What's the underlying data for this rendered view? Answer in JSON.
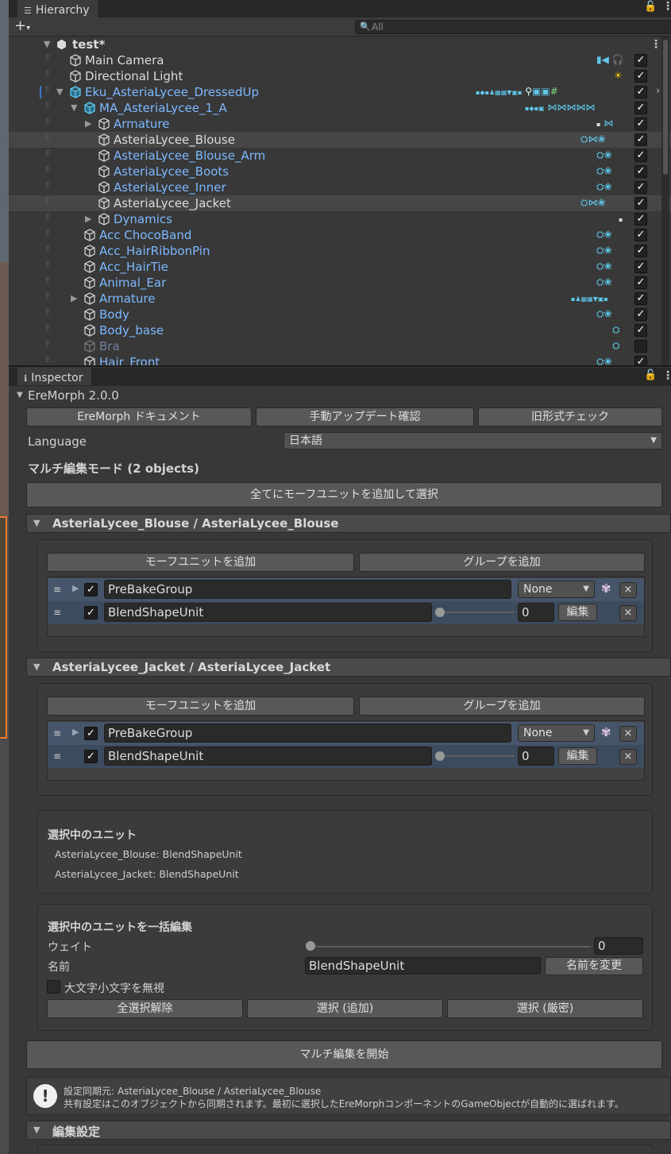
{
  "hierarchy": {
    "tab_title": "Hierarchy",
    "search_placeholder": "All",
    "scene_name": "test*",
    "rows": [
      {
        "name": "Main Camera"
      },
      {
        "name": "Directional Light"
      },
      {
        "name": "Eku_AsteriaLycee_DressedUp"
      },
      {
        "name": "MA_AsteriaLycee_1_A"
      },
      {
        "name": "Armature"
      },
      {
        "name": "AsteriaLycee_Blouse"
      },
      {
        "name": "AsteriaLycee_Blouse_Arm"
      },
      {
        "name": "AsteriaLycee_Boots"
      },
      {
        "name": "AsteriaLycee_Inner"
      },
      {
        "name": "AsteriaLycee_Jacket"
      },
      {
        "name": "Dynamics"
      },
      {
        "name": "Acc ChocoBand"
      },
      {
        "name": "Acc_HairRibbonPin"
      },
      {
        "name": "Acc_HairTie"
      },
      {
        "name": "Animal_Ear"
      },
      {
        "name": "Armature"
      },
      {
        "name": "Body"
      },
      {
        "name": "Body_base"
      },
      {
        "name": "Bra"
      },
      {
        "name": "Hair_Front"
      }
    ]
  },
  "inspector": {
    "tab_title": "Inspector",
    "component_title": "EreMorph 2.0.0",
    "top_buttons": [
      "EreMorph ドキュメント",
      "手動アップデート確認",
      "旧形式チェック"
    ],
    "language_label": "Language",
    "language_value": "日本語",
    "multi_edit_header": "マルチ編集モード (2 objects)",
    "add_all_button": "全てにモーフユニットを追加して選択",
    "sections": [
      {
        "title": "AsteriaLycee_Blouse / AsteriaLycee_Blouse",
        "add_unit_button": "モーフユニットを追加",
        "add_group_button": "グループを追加",
        "group_name": "PreBakeGroup",
        "group_select": "None",
        "unit_name": "BlendShapeUnit",
        "unit_value": "0",
        "edit_button": "編集",
        "remove_symbol": "×"
      },
      {
        "title": "AsteriaLycee_Jacket / AsteriaLycee_Jacket",
        "add_unit_button": "モーフユニットを追加",
        "add_group_button": "グループを追加",
        "group_name": "PreBakeGroup",
        "group_select": "None",
        "unit_name": "BlendShapeUnit",
        "unit_value": "0",
        "edit_button": "編集",
        "remove_symbol": "×"
      }
    ],
    "selected_units": {
      "header": "選択中のユニット",
      "items": [
        "AsteriaLycee_Blouse:  BlendShapeUnit",
        "AsteriaLycee_Jacket:  BlendShapeUnit"
      ]
    },
    "bulk_edit": {
      "header": "選択中のユニットを一括編集",
      "weight_label": "ウェイト",
      "weight_value": "0",
      "name_label": "名前",
      "name_value": "BlendShapeUnit",
      "rename_button": "名前を変更",
      "ignore_case_label": "大文字小文字を無視",
      "deselect_button": "全選択解除",
      "select_add_button": "選択 (追加)",
      "select_strict_button": "選択 (厳密)"
    },
    "start_multi_edit_button": "マルチ編集を開始",
    "help": {
      "line1": "設定同期元: AsteriaLycee_Blouse / AsteriaLycee_Blouse",
      "line2": "共有設定はこのオブジェクトから同期されます。最初に選択したEreMorphコンポーネントのGameObjectが自動的に選ばれます。"
    },
    "edit_settings_header": "編集設定"
  },
  "colors": {
    "accent": "#7cb8ff",
    "selection": "#46556a",
    "icon": "#5fc8ec"
  }
}
